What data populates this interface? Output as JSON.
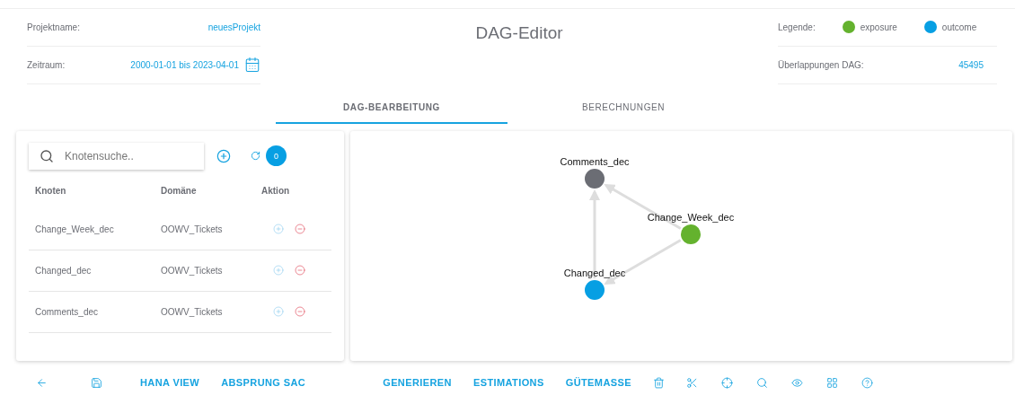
{
  "header": {
    "title": "DAG-Editor",
    "fields_left": [
      {
        "label": "Projektname:",
        "value": "neuesProjekt",
        "kind": "text"
      },
      {
        "label": "Zeitraum:",
        "value": "2000-01-01 bis 2023-04-01",
        "kind": "date"
      }
    ],
    "legend": {
      "label": "Legende:",
      "items": [
        {
          "label": "exposure",
          "color": "#64b22e"
        },
        {
          "label": "outcome",
          "color": "#079fe3"
        }
      ]
    },
    "overlap": {
      "label": "Überlappungen DAG:",
      "value": "45495"
    }
  },
  "tabs": [
    {
      "label": "DAG-BEARBEITUNG",
      "selected": true
    },
    {
      "label": "BERECHNUNGEN",
      "selected": false
    }
  ],
  "node_panel": {
    "search": {
      "placeholder": "Knotensuche.."
    },
    "counter": "0",
    "columns": [
      "Knoten",
      "Domäne",
      "Aktion"
    ],
    "rows": [
      {
        "node": "Change_Week_dec",
        "domain": "OOWV_Tickets"
      },
      {
        "node": "Changed_dec",
        "domain": "OOWV_Tickets"
      },
      {
        "node": "Comments_dec",
        "domain": "OOWV_Tickets"
      }
    ]
  },
  "graph": {
    "nodes": [
      {
        "label": "Comments_dec",
        "color": "#6b6d74"
      },
      {
        "label": "Change_Week_dec",
        "color": "#64b22e"
      },
      {
        "label": "Changed_dec",
        "color": "#079fe3"
      }
    ]
  },
  "toolbar": {
    "left_actions": [
      "HANA VIEW",
      "ABSPRUNG SAC"
    ],
    "center_actions": [
      "GENERIEREN",
      "ESTIMATIONS",
      "GÜTEMASSE"
    ]
  }
}
